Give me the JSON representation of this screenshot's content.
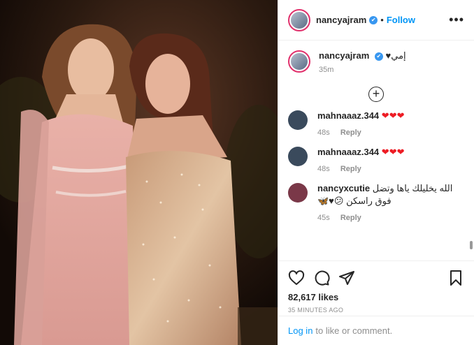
{
  "post": {
    "username": "nancyajram",
    "verified_mark": "✔",
    "dot": "•",
    "follow_label": "Follow",
    "more_label": "•••"
  },
  "caption": {
    "username": "nancyajram",
    "text": "إمي♥",
    "time": "35m"
  },
  "load_more_label": "+",
  "comments": [
    {
      "username": "mahnaaaz.344",
      "text": "❤❤❤",
      "time": "48s",
      "reply": "Reply",
      "avatar_color": "#3a4a5c"
    },
    {
      "username": "mahnaaaz.344",
      "text": "❤❤❤",
      "time": "48s",
      "reply": "Reply",
      "avatar_color": "#3a4a5c"
    },
    {
      "username": "nancyxcutie",
      "text_line1": "الله يخليلك ياها وتضل",
      "text_line2": "فوق راسكن 😕♥🦋",
      "time": "45s",
      "reply": "Reply",
      "avatar_color": "#7a3848"
    }
  ],
  "likes": "82,617 likes",
  "posted_ago": "35 MINUTES AGO",
  "login": {
    "link": "Log in",
    "rest": "to like or comment."
  },
  "icons": [
    "heart-icon",
    "comment-icon",
    "share-icon",
    "bookmark-icon",
    "more-icon",
    "add-circle-icon"
  ],
  "colors": {
    "accent": "#0095f6",
    "heart": "#ed1c24",
    "verified": "#3897f0"
  }
}
